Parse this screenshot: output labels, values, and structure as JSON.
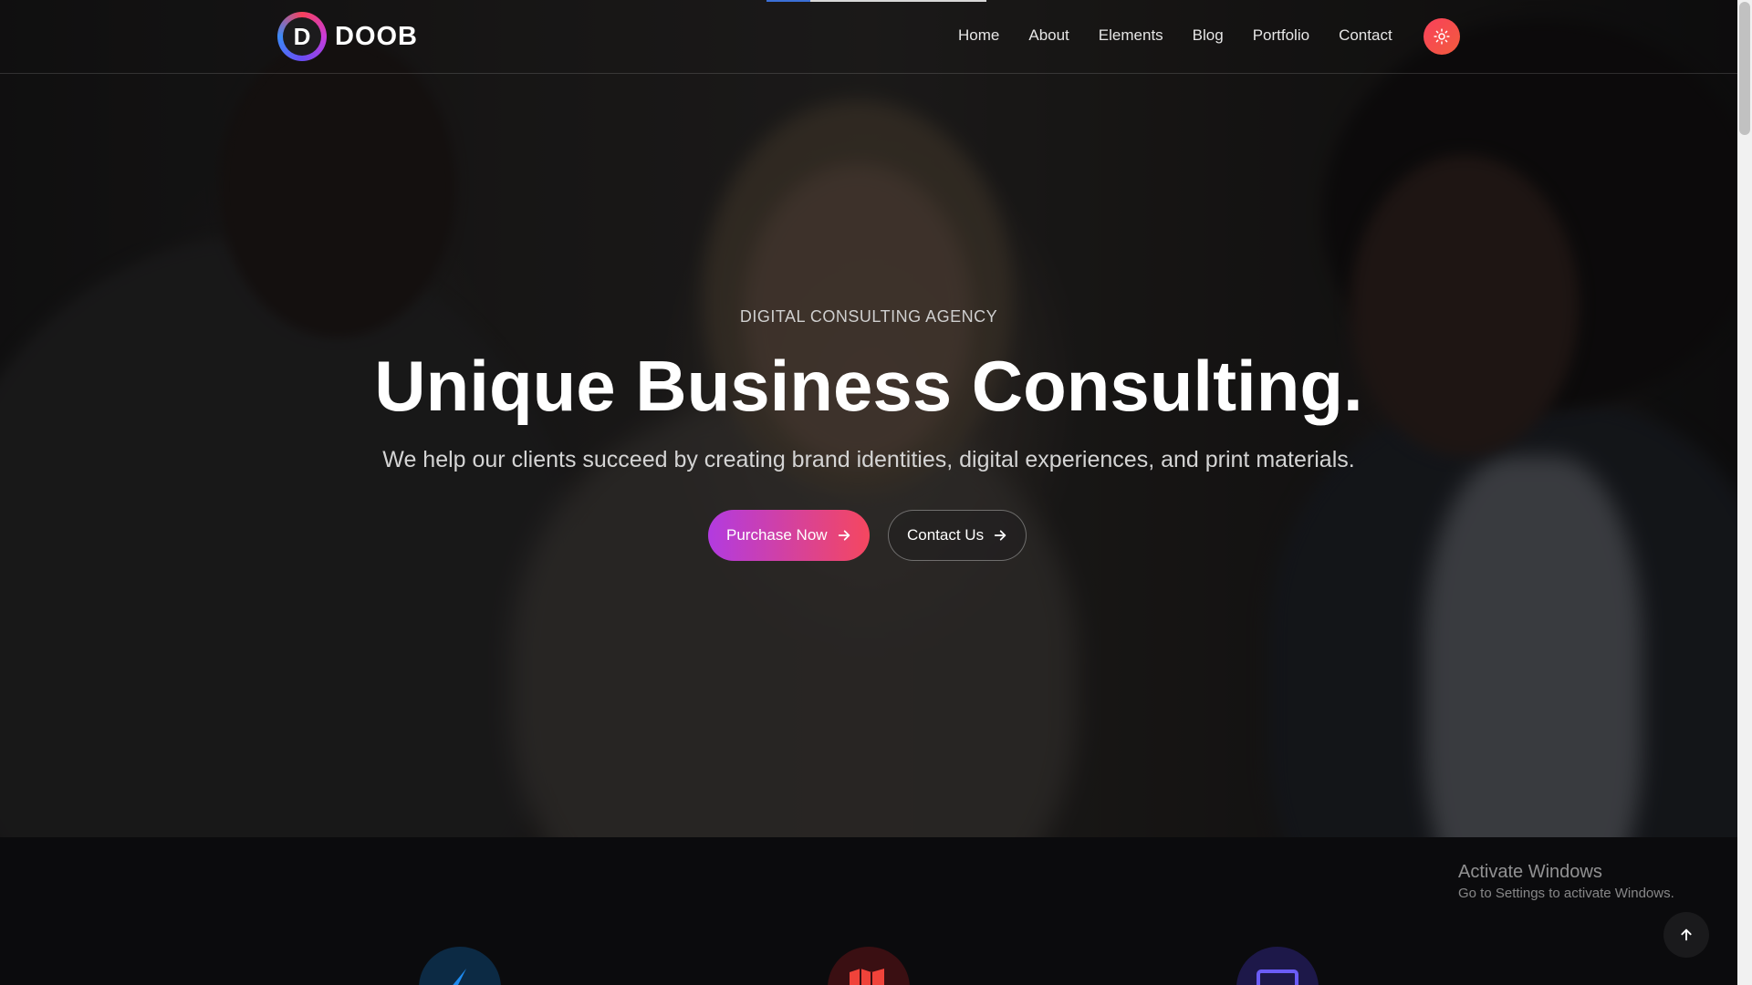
{
  "brand": {
    "name": "DOOB",
    "mark_letter": "D"
  },
  "nav": {
    "items": [
      {
        "label": "Home"
      },
      {
        "label": "About"
      },
      {
        "label": "Elements"
      },
      {
        "label": "Blog"
      },
      {
        "label": "Portfolio"
      },
      {
        "label": "Contact"
      }
    ],
    "theme_toggle_icon": "sun-icon"
  },
  "hero": {
    "eyebrow": "DIGITAL CONSULTING AGENCY",
    "title": "Unique Business Consulting.",
    "subtitle": "We help our clients succeed by creating brand identities, digital experiences, and print materials.",
    "primary_button": {
      "label": "Purchase Now",
      "icon": "arrow-right-icon"
    },
    "secondary_button": {
      "label": "Contact Us",
      "icon": "arrow-right-icon"
    }
  },
  "services": {
    "icons": [
      "paper-plane-icon",
      "map-icon",
      "monitor-icon"
    ]
  },
  "watermark": {
    "title": "Activate Windows",
    "subtitle": "Go to Settings to activate Windows."
  },
  "back_to_top": {
    "icon": "arrow-up-icon"
  },
  "colors": {
    "accent_start": "#b23be0",
    "accent_end": "#f5475f",
    "theme_button": "#f9415b",
    "background": "#0b0b0d"
  }
}
